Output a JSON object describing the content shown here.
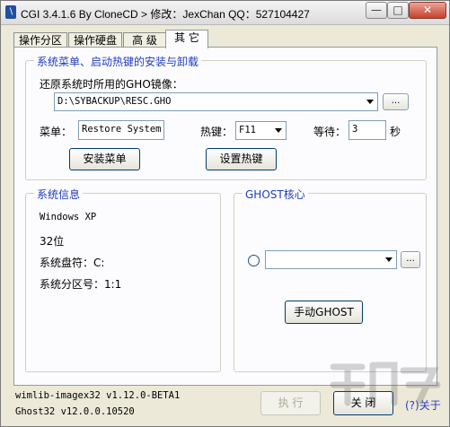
{
  "window": {
    "title": "CGI 3.4.1.6 By CloneCD > 修改：JexChan  QQ：527104427",
    "buttons": {
      "minimize": "—",
      "maximize": "□",
      "close": "✕"
    }
  },
  "tabs": [
    {
      "label": "操作分区"
    },
    {
      "label": "操作硬盘"
    },
    {
      "label": "高 级"
    },
    {
      "label": "其 它"
    }
  ],
  "menu_group": {
    "title": "系统菜单、启动热键的安装与卸载",
    "image_label": "还原系统时所用的GHO镜像：",
    "image_path": "D:\\SYBACKUP\\RESC.GHO",
    "browse_label": "...",
    "menu_label": "菜单：",
    "menu_value": "Restore System",
    "hotkey_label": "热键：",
    "hotkey_value": "F11",
    "wait_label": "等待：",
    "wait_value": "3",
    "wait_unit": "秒",
    "install_menu_button": "安装菜单",
    "set_hotkey_button": "设置热键"
  },
  "sysinfo_group": {
    "title": "系统信息",
    "os": "Windows XP",
    "bits": "32位",
    "drive_label": "系统盘符：C:",
    "partition_label": "系统分区号：1:1"
  },
  "ghost_group": {
    "title": "GHOST核心",
    "combo_value": "",
    "browse_label": "...",
    "manual_button": "手动GHOST"
  },
  "footer": {
    "wimlib": "wimlib-imagex32 v1.12.0-BETA1",
    "ghost": "Ghost32 v12.0.0.10520",
    "execute_button": "执 行",
    "close_button": "关 闭",
    "about_link": "(?)关于"
  }
}
